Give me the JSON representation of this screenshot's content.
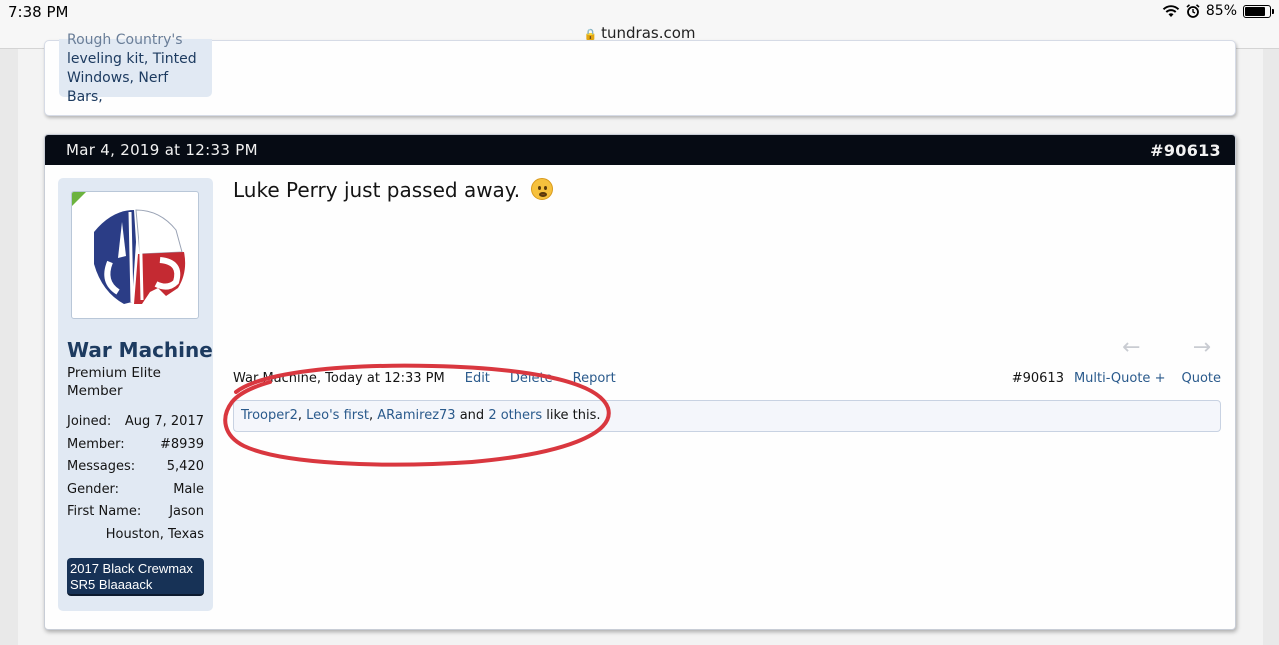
{
  "status_bar": {
    "time": "7:38 PM",
    "battery": "85%",
    "url": "tundras.com"
  },
  "prev_post": {
    "signature_lines": [
      "Rough Country's",
      "leveling kit, Tinted",
      "Windows, Nerf Bars,"
    ]
  },
  "post": {
    "date": "Mar 4, 2019 at 12:33 PM",
    "number": "#90613",
    "message": "Luke Perry just passed away.",
    "user": {
      "name": "War Machine",
      "title": "Premium Elite Member",
      "stats": [
        {
          "label": "Joined:",
          "value": "Aug 7, 2017"
        },
        {
          "label": "Member:",
          "value": "#8939"
        },
        {
          "label": "Messages:",
          "value": "5,420"
        },
        {
          "label": "Gender:",
          "value": "Male"
        },
        {
          "label": "First Name:",
          "value": "Jason"
        }
      ],
      "location": "Houston, Texas",
      "truck": "2017 Black Crewmax SR5 Blaaaack"
    },
    "footer": {
      "author_time": "War Machine, Today at 12:33 PM",
      "edit": "Edit",
      "delete": "Delete",
      "report": "Report",
      "post_number": "#90613",
      "multi_quote": "Multi-Quote +",
      "quote": "Quote"
    },
    "likes": {
      "names": [
        "Trooper2",
        "Leo's first",
        "ARamirez73"
      ],
      "sep": ", ",
      "and": " and ",
      "others": "2 others",
      "suffix": " like this."
    }
  },
  "colors": {
    "header_bg": "#060b14",
    "user_panel": "#e1e9f3",
    "link": "#2a5a8c",
    "username": "#1d3b60",
    "annotation": "#d9373f",
    "online": "#6cb33f"
  },
  "icons": {
    "wifi": "wifi-icon",
    "alarm": "alarm-icon",
    "battery": "battery-icon",
    "lock": "lock-icon",
    "emoji": "sad-face-emoji-icon",
    "prev": "arrow-left-icon",
    "next": "arrow-right-icon"
  }
}
